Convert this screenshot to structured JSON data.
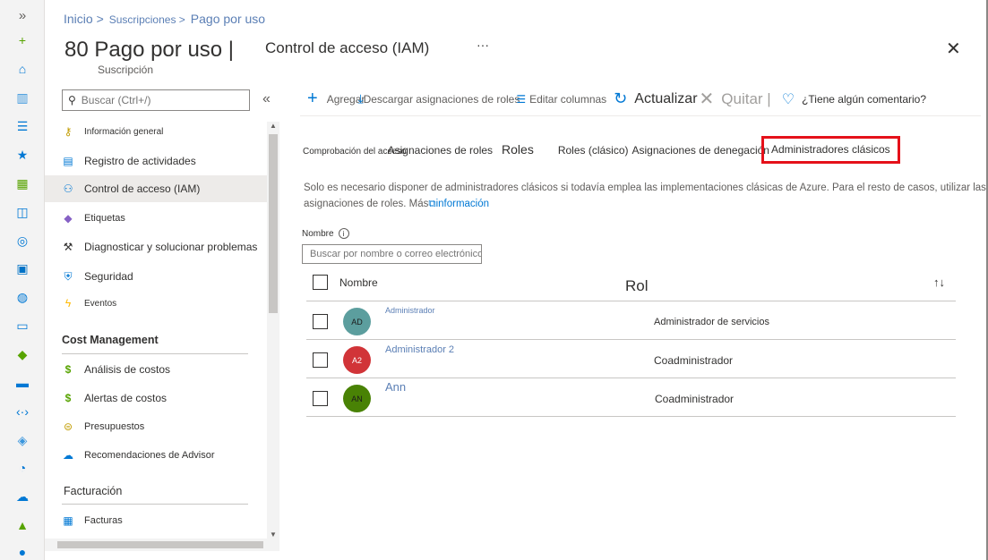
{
  "breadcrumb": {
    "items": [
      "Inicio >",
      "Suscripciones >",
      "Pago por uso"
    ]
  },
  "header": {
    "title": "80 Pago por uso |",
    "subtitle": "Suscripción",
    "blade_title": "Control de acceso (IAM)",
    "more": "···",
    "close": "✕"
  },
  "sidebar": {
    "search_placeholder": "Buscar (Ctrl+/)",
    "collapse": "«",
    "items": [
      {
        "label": "Información general",
        "icon": "key-icon",
        "glyph": "🔑",
        "color": "#c19c00"
      },
      {
        "label": "Registro de actividades",
        "icon": "log-icon",
        "glyph": "▤",
        "color": "#0078d4"
      },
      {
        "label": "Control de acceso (IAM)",
        "icon": "people-icon",
        "glyph": "👥",
        "color": "#0078d4"
      },
      {
        "label": "Etiquetas",
        "icon": "tag-icon",
        "glyph": "◆",
        "color": "#8661c5"
      },
      {
        "label": "Diagnosticar y solucionar problemas",
        "icon": "wrench-icon",
        "glyph": "🔧",
        "color": "#323130"
      },
      {
        "label": "Seguridad",
        "icon": "shield-icon",
        "glyph": "⛨",
        "color": "#0078d4"
      },
      {
        "label": "Eventos",
        "icon": "lightning-icon",
        "glyph": "⚡",
        "color": "#ffb900"
      }
    ],
    "cost_section": "Cost Management",
    "cost_items": [
      {
        "label": "Análisis de costos",
        "icon": "cost-analysis-icon",
        "glyph": "$",
        "color": "#57a300"
      },
      {
        "label": "Alertas de costos",
        "icon": "cost-alert-icon",
        "glyph": "$",
        "color": "#57a300"
      },
      {
        "label": "Presupuestos",
        "icon": "budget-icon",
        "glyph": "$",
        "color": "#c19c00"
      },
      {
        "label": "Recomendaciones de Advisor",
        "icon": "advisor-icon",
        "glyph": "☁",
        "color": "#0078d4"
      }
    ],
    "billing_section": "Facturación",
    "billing_items": [
      {
        "label": "Facturas",
        "icon": "invoice-icon",
        "glyph": "▦",
        "color": "#0078d4"
      }
    ]
  },
  "toolbar": {
    "add": "Agregar",
    "download": "Descargar asignaciones de roles",
    "edit_columns": "Editar columnas",
    "refresh": "Actualizar",
    "remove": "Quitar |",
    "feedback": "¿Tiene algún comentario?"
  },
  "tabs": {
    "check_access": "Comprobación del acceso",
    "role_assignments": "Asignaciones de roles",
    "roles": "Roles",
    "roles_classic": "Roles (clásico)",
    "deny_assignments": "Asignaciones de denegación",
    "classic_admins": "Administradores clásicos"
  },
  "info": {
    "text": "Solo es necesario disponer de administradores clásicos si todavía emplea las implementaciones clásicas de Azure. Para el resto de casos, utilizar las asignaciones de roles. Más",
    "link": "información"
  },
  "filter": {
    "label": "Nombre",
    "placeholder": "Buscar por nombre o correo electrónico"
  },
  "table": {
    "col_name": "Nombre",
    "col_role": "Rol",
    "sort": "↑↓",
    "rows": [
      {
        "initials": "AD",
        "name": "Administrador",
        "role": "Administrador de servicios",
        "color": "#5c9e9e"
      },
      {
        "initials": "A2",
        "name": "Administrador 2",
        "role": "Coadministrador",
        "color": "#d13438"
      },
      {
        "initials": "AN",
        "name": "Ann",
        "role": "Coadministrador",
        "color": "#498205"
      }
    ]
  },
  "rail": {
    "expand": "»",
    "icons": [
      {
        "name": "plus-icon",
        "glyph": "+",
        "color": "#57a300"
      },
      {
        "name": "home-icon",
        "glyph": "⌂",
        "color": "#0078d4"
      },
      {
        "name": "dashboard-icon",
        "glyph": "▥",
        "color": "#3a96dd"
      },
      {
        "name": "list-icon",
        "glyph": "☰",
        "color": "#0078d4"
      },
      {
        "name": "star-icon",
        "glyph": "★",
        "color": "#0078d4"
      },
      {
        "name": "grid-icon",
        "glyph": "▦",
        "color": "#57a300"
      },
      {
        "name": "cube-icon",
        "glyph": "◫",
        "color": "#0078d4"
      },
      {
        "name": "globe-icon",
        "glyph": "◎",
        "color": "#0078d4"
      },
      {
        "name": "sql-icon",
        "glyph": "▣",
        "color": "#0072c6"
      },
      {
        "name": "planet-icon",
        "glyph": "◍",
        "color": "#0078d4"
      },
      {
        "name": "monitor-icon",
        "glyph": "▭",
        "color": "#0078d4"
      },
      {
        "name": "diamond-icon",
        "glyph": "◆",
        "color": "#57a300"
      },
      {
        "name": "storage-icon",
        "glyph": "▬",
        "color": "#0078d4"
      },
      {
        "name": "network-icon",
        "glyph": "‹·›",
        "color": "#0078d4"
      },
      {
        "name": "pyramid-icon",
        "glyph": "◈",
        "color": "#3a96dd"
      },
      {
        "name": "gauge-icon",
        "glyph": "◔",
        "color": "#0078d4"
      },
      {
        "name": "cloud-icon",
        "glyph": "☁",
        "color": "#0078d4"
      },
      {
        "name": "lock-icon",
        "glyph": "▲",
        "color": "#57a300"
      },
      {
        "name": "person-icon",
        "glyph": "●",
        "color": "#0078d4"
      }
    ]
  }
}
